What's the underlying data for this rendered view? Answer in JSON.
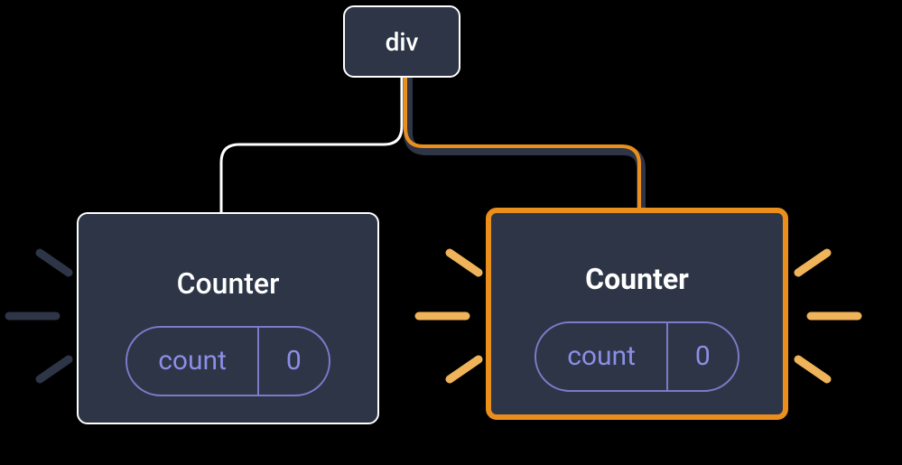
{
  "root": {
    "label": "div"
  },
  "left": {
    "title": "Counter",
    "state_label": "count",
    "state_value": "0"
  },
  "right": {
    "title": "Counter",
    "state_label": "count",
    "state_value": "0"
  },
  "colors": {
    "bg_node": "#2d3546",
    "accent_purple": "#8b8ee6",
    "accent_orange": "#eb8f1c",
    "stroke_white": "#ffffff",
    "stroke_dark": "#2d3546"
  }
}
